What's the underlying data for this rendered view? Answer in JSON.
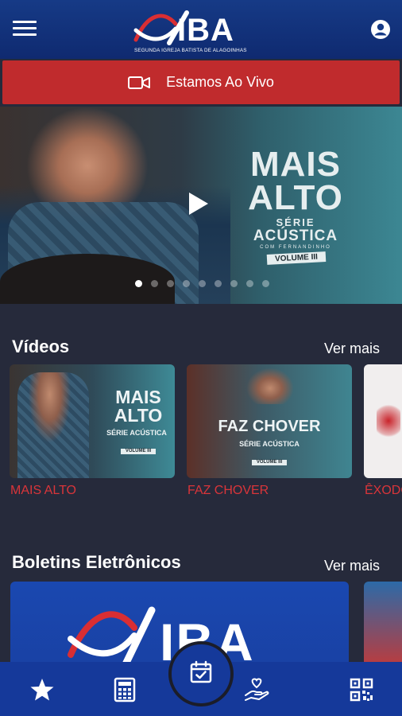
{
  "header": {
    "logo_text": "IBA",
    "logo_subtitle": "SEGUNDA IGREJA BATISTA DE ALAGOINHAS",
    "menu_icon": "hamburger-menu-icon",
    "account_icon": "account-circle-icon"
  },
  "live": {
    "label": "Estamos Ao Vivo",
    "icon": "video-camera-icon",
    "color": "#c02b2d"
  },
  "hero": {
    "title_line1": "MAIS",
    "title_line2": "ALTO",
    "serie": "SÉRIE",
    "acustica": "ACÚSTICA",
    "com": "COM FERNANDINHO",
    "volume": "VOLUME III",
    "slide_count": 9,
    "active_slide": 1
  },
  "videos": {
    "title": "Vídeos",
    "see_more": "Ver mais",
    "items": [
      {
        "caption": "MAIS ALTO",
        "big": "MAIS ALTO",
        "sub": "SÉRIE ACÚSTICA",
        "vol": "VOLUME III"
      },
      {
        "caption": "FAZ CHOVER",
        "big": "FAZ CHOVER",
        "sub": "SÉRIE ACÚSTICA",
        "vol": "VOLUME III"
      },
      {
        "caption": "ÊXODO"
      }
    ]
  },
  "bulletins": {
    "title": "Boletins Eletrônicos",
    "see_more": "Ver mais",
    "logo_text": "IBA"
  },
  "bottom_nav": [
    {
      "icon": "star-icon"
    },
    {
      "icon": "calculator-icon"
    },
    {
      "icon": "calendar-check-icon"
    },
    {
      "icon": "hand-heart-icon"
    },
    {
      "icon": "qr-code-icon"
    }
  ],
  "colors": {
    "header": "#15399a",
    "accent_red": "#d9353a",
    "background": "#262a3b"
  }
}
